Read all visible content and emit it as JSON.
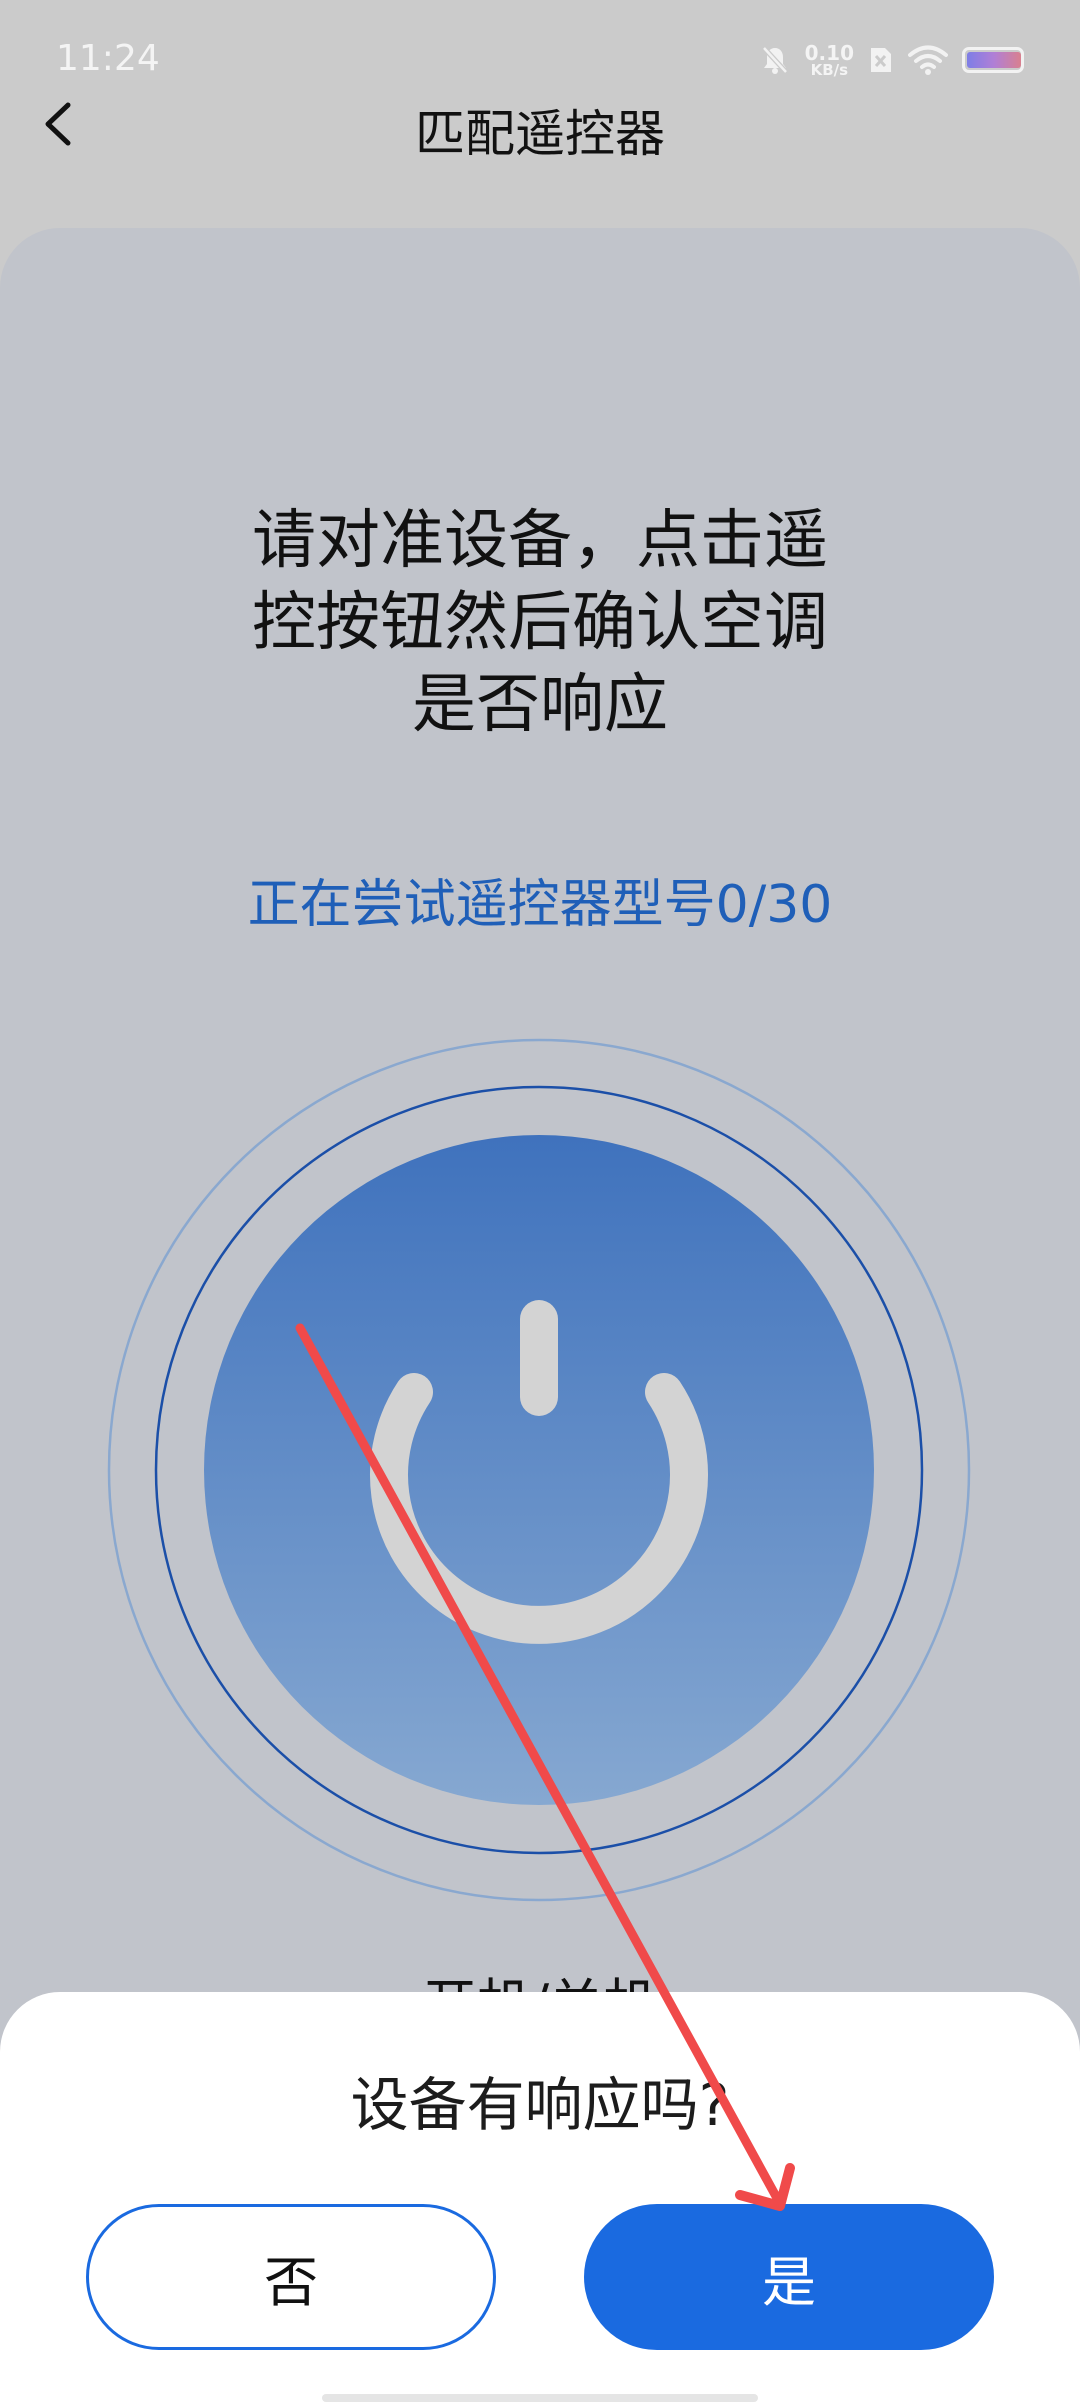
{
  "status_bar": {
    "time": "11:24",
    "net_speed_value": "0.10",
    "net_speed_unit": "KB/s",
    "icons": [
      "bell-muted-icon",
      "sim-x-icon",
      "wifi-icon",
      "battery-icon"
    ]
  },
  "header": {
    "back_icon": "chevron-left-icon",
    "title": "匹配遥控器"
  },
  "main": {
    "instruction_lines": [
      "请对准设备，点击遥",
      "控按钮然后确认空调",
      "是否响应"
    ],
    "progress_text": "正在尝试遥控器型号0/30",
    "power_icon": "power-icon",
    "power_label": "开机/关机"
  },
  "sheet": {
    "question": "设备有响应吗?",
    "no_label": "否",
    "yes_label": "是"
  },
  "colors": {
    "accent": "#1a6ae0",
    "progress_text": "#1f5fb8",
    "card_bg": "#c1c4cb",
    "annotation_arrow": "#f04a4a"
  }
}
